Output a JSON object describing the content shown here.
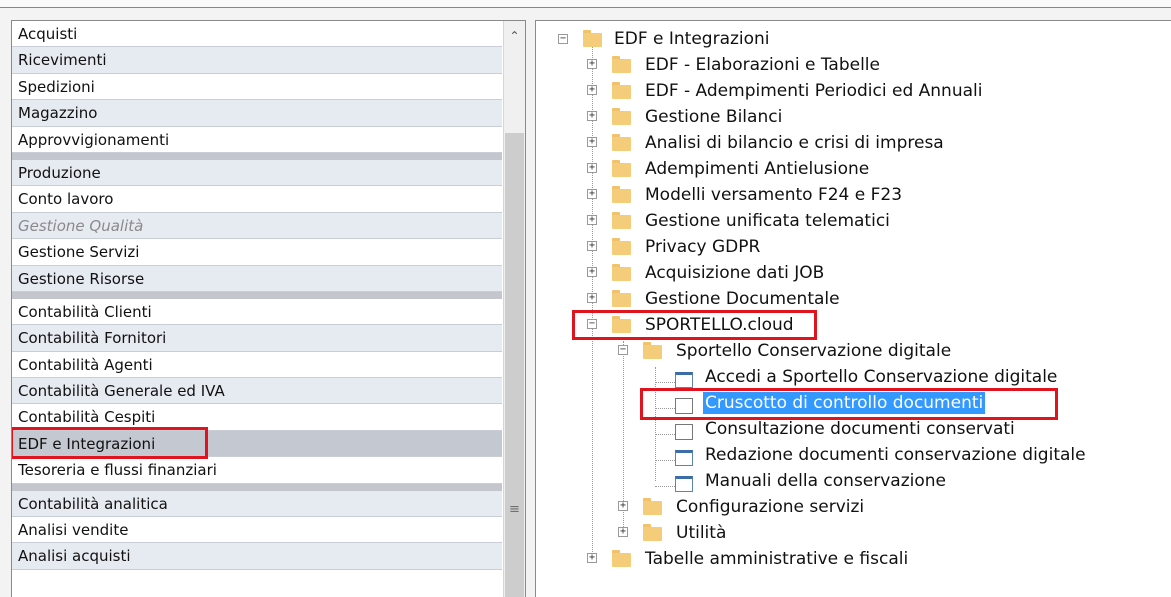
{
  "left_menu": {
    "items": [
      {
        "label": "Acquisti"
      },
      {
        "label": "Ricevimenti"
      },
      {
        "label": "Spedizioni"
      },
      {
        "label": "Magazzino"
      },
      {
        "label": "Approvvigionamenti"
      },
      {
        "label": "Produzione"
      },
      {
        "label": "Conto lavoro"
      },
      {
        "label": "Gestione Qualità"
      },
      {
        "label": "Gestione Servizi"
      },
      {
        "label": "Gestione Risorse"
      },
      {
        "label": "Contabilità Clienti"
      },
      {
        "label": "Contabilità Fornitori"
      },
      {
        "label": "Contabilità Agenti"
      },
      {
        "label": "Contabilità Generale ed IVA"
      },
      {
        "label": "Contabilità Cespiti"
      },
      {
        "label": "EDF e Integrazioni"
      },
      {
        "label": "Tesoreria e flussi finanziari"
      },
      {
        "label": "Contabilità analitica"
      },
      {
        "label": "Analisi vendite"
      },
      {
        "label": "Analisi acquisti"
      }
    ],
    "selected": "EDF e Integrazioni",
    "disabled": "Gestione Qualità"
  },
  "tree": {
    "root": "EDF e Integrazioni",
    "nodes": [
      {
        "label": "EDF - Elaborazioni e Tabelle"
      },
      {
        "label": "EDF - Adempimenti Periodici ed Annuali"
      },
      {
        "label": "Gestione Bilanci"
      },
      {
        "label": "Analisi di bilancio e crisi di impresa"
      },
      {
        "label": "Adempimenti Antielusione"
      },
      {
        "label": "Modelli versamento F24 e F23"
      },
      {
        "label": "Gestione unificata telematici"
      },
      {
        "label": "Privacy GDPR"
      },
      {
        "label": "Acquisizione dati JOB"
      },
      {
        "label": "Gestione Documentale"
      },
      {
        "label": "SPORTELLO.cloud"
      },
      {
        "label": "Sportello Conservazione digitale"
      },
      {
        "label": "Accedi a Sportello Conservazione digitale"
      },
      {
        "label": "Cruscotto di controllo documenti"
      },
      {
        "label": "Consultazione documenti conservati"
      },
      {
        "label": "Redazione documenti conservazione digitale"
      },
      {
        "label": "Manuali della conservazione"
      },
      {
        "label": "Configurazione servizi"
      },
      {
        "label": "Utilità"
      },
      {
        "label": "Tabelle amministrative e fiscali"
      }
    ],
    "selected": "Cruscotto di controllo documenti"
  },
  "icons": {
    "expand": "plus-box-icon",
    "collapse": "minus-box-icon",
    "folder": "folder-icon",
    "program": "window-icon"
  },
  "colors": {
    "selection": "#3399ff",
    "annotation": "#e0141e",
    "list_selected": "#c4c8d0"
  }
}
